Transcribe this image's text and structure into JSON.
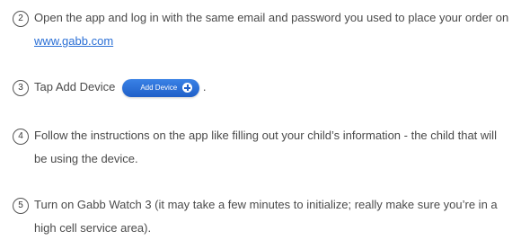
{
  "steps": [
    {
      "number": "2",
      "text_before": "Open the app and log in with the same email and password you used to place your order on ",
      "link": "www.gabb.com",
      "text_after": ""
    },
    {
      "number": "3",
      "text_before": "Tap Add Device",
      "button_label": "Add Device",
      "text_after": "."
    },
    {
      "number": "4",
      "text": "Follow the instructions on the app like filling out your child’s information - the child that will be using the device."
    },
    {
      "number": "5",
      "text": "Turn on Gabb Watch 3 (it may take a few minutes to initialize; really make sure you’re in a high cell service area)."
    }
  ],
  "colors": {
    "link": "#2a6fd6",
    "button": "#2a6fd6",
    "text": "#4a4a4a"
  }
}
